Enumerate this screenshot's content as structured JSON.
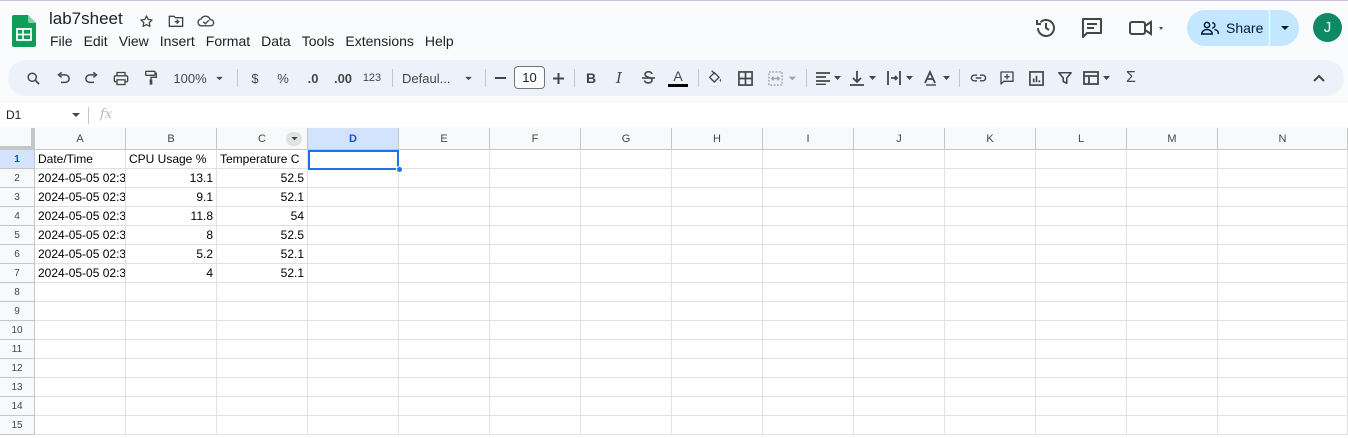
{
  "app": {
    "doc_title": "lab7sheet",
    "menu": [
      "File",
      "Edit",
      "View",
      "Insert",
      "Format",
      "Data",
      "Tools",
      "Extensions",
      "Help"
    ],
    "share_label": "Share",
    "avatar_initial": "J"
  },
  "toolbar": {
    "zoom": "100%",
    "currency": "$",
    "percent": "%",
    "dec_decrease": ".0",
    "dec_increase": ".00",
    "format_more": "123",
    "font": "Defaul...",
    "font_size": "10"
  },
  "formula_bar": {
    "name_box": "D1",
    "fx": "fx",
    "value": ""
  },
  "sheet": {
    "columns": [
      "A",
      "B",
      "C",
      "D",
      "E",
      "F",
      "G",
      "H",
      "I",
      "J",
      "K",
      "L",
      "M",
      "N"
    ],
    "selected_column": "D",
    "rows": [
      "1",
      "2",
      "3",
      "4",
      "5",
      "6",
      "7",
      "8",
      "9",
      "10",
      "11",
      "12",
      "13",
      "14",
      "15"
    ],
    "selected_row": "1",
    "headers": [
      "Date/Time",
      "CPU Usage %",
      "Temperature C"
    ],
    "data": [
      [
        "2024-05-05 02:3",
        "13.1",
        "52.5"
      ],
      [
        "2024-05-05 02:3",
        "9.1",
        "52.1"
      ],
      [
        "2024-05-05 02:3",
        "11.8",
        "54"
      ],
      [
        "2024-05-05 02:3",
        "8",
        "52.5"
      ],
      [
        "2024-05-05 02:3",
        "5.2",
        "52.1"
      ],
      [
        "2024-05-05 02:3",
        "4",
        "52.1"
      ]
    ],
    "active_cell": "D1"
  },
  "colors": {
    "accent": "#1a73e8",
    "share_bg": "#c2e7ff",
    "avatar_bg": "#0e8a63",
    "logo_green": "#0f9d58"
  }
}
